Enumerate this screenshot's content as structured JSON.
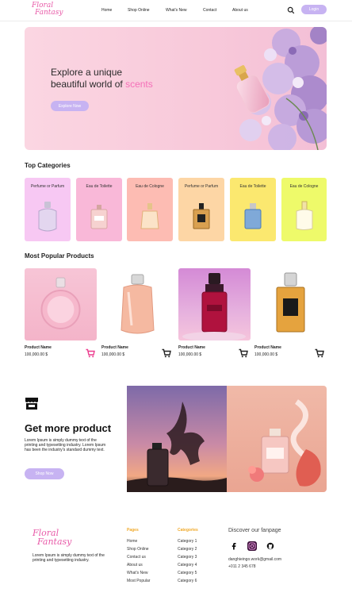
{
  "header": {
    "logo_line1": "Floral",
    "logo_line2": "Fantasy",
    "nav": [
      "Home",
      "Shop Online",
      "What's New",
      "Contact",
      "About us"
    ],
    "login_label": "Login"
  },
  "hero": {
    "title_line1": "Explore a unique",
    "title_line2_plain": "beautiful world of ",
    "title_line2_accent": "scents",
    "button_label": "Explore Now"
  },
  "categories": {
    "title": "Top Categories",
    "items": [
      {
        "label": "Perfume or Parfum",
        "bg": "#f7c8f3"
      },
      {
        "label": "Eau de Toilette",
        "bg": "#f9b8d8"
      },
      {
        "label": "Eau de Cologne",
        "bg": "#fdbcb3"
      },
      {
        "label": "Perfume or Parfum",
        "bg": "#fdd6a5"
      },
      {
        "label": "Eau de Toilette",
        "bg": "#fbe86f"
      },
      {
        "label": "Eau de Cologne",
        "bg": "#eefa6a"
      }
    ]
  },
  "products": {
    "title": "Most Popular Products",
    "items": [
      {
        "name": "Product Name",
        "price": "100,000.00 $"
      },
      {
        "name": "Product Name",
        "price": "100,000.00 $"
      },
      {
        "name": "Product Name",
        "price": "100,000.00 $"
      },
      {
        "name": "Product Name",
        "price": "100,000.00 $"
      }
    ]
  },
  "promo": {
    "title": "Get more product",
    "text": "Lorem Ipsum is simply dummy text of the printing and typesetting industry. Lorem Ipsum has been the industry's standard dummy text.",
    "button_label": "Shop Now"
  },
  "footer": {
    "logo_line1": "Floral",
    "logo_line2": "Fantasy",
    "description": "Lorem Ipsum is simply dummy text of the printing and typesetting industry.",
    "pages_title": "Pages",
    "pages": [
      "Home",
      "Shop Online",
      "Contact us",
      "About us",
      "What's New",
      "Most Popular"
    ],
    "categories_title": "Categories",
    "categories": [
      "Category 1",
      "Category 2",
      "Category 3",
      "Category 4",
      "Category 5",
      "Category 6"
    ],
    "fanpage_title": "Discover our fanpage",
    "email": "danghieingo.work@gmail.com",
    "phone": "+011 2 345 678"
  },
  "colors": {
    "brand_pink": "#e85aa8",
    "accent_purple": "#c7b3f2",
    "footer_heading": "#f0a92a",
    "cart_icon": "#ec3c8e"
  }
}
